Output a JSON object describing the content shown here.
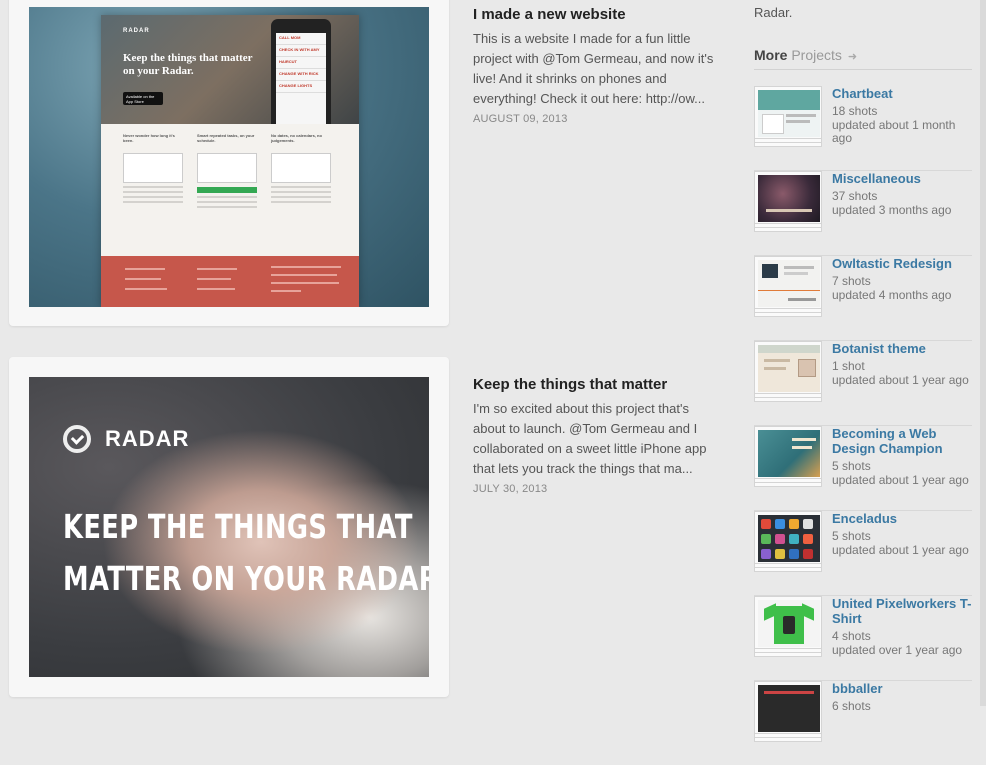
{
  "posts": [
    {
      "title": "I made a new website",
      "excerpt": "This is a website I made for a fun little project with @Tom Germeau, and now it's live! And it shrinks on phones and everything! Check it out here: http://ow...",
      "date": "AUGUST 09, 2013",
      "mock": {
        "logo": "RADAR",
        "headline": "Keep the things that matter on your Radar.",
        "app_store": "Available on the App Store",
        "phone_rows": [
          "CALL MOM",
          "CHECK IN WITH AMY",
          "HAIRCUT",
          "CHANGE WITH RICK",
          "CHANGE LIGHTS"
        ],
        "columns": [
          "Never wonder how long it's been.",
          "Smart repeated tasks, on your schedule.",
          "No dates, no calendars, no judgements."
        ]
      }
    },
    {
      "title": "Keep the things that matter",
      "excerpt": "I'm so excited about this project that's about to launch. @Tom Germeau and I collaborated on a sweet little iPhone app that lets you track the things that ma...",
      "date": "JULY 30, 2013",
      "mock": {
        "logo": "RADAR",
        "headline_line1": "KEEP THE THINGS THAT",
        "headline_line2": "MATTER ON YOUR RADAR."
      }
    }
  ],
  "sidebar": {
    "top_text": "Radar.",
    "heading_strong": "More",
    "heading_light": "Projects",
    "heading_arrow": "➜",
    "projects": [
      {
        "name": "Chartbeat",
        "shots": "18 shots",
        "updated": "updated about 1 month ago"
      },
      {
        "name": "Miscellaneous",
        "shots": "37 shots",
        "updated": "updated 3 months ago"
      },
      {
        "name": "Owltastic Redesign",
        "shots": "7 shots",
        "updated": "updated 4 months ago"
      },
      {
        "name": "Botanist theme",
        "shots": "1 shot",
        "updated": "updated about 1 year ago"
      },
      {
        "name": "Becoming a Web Design Champion",
        "shots": "5 shots",
        "updated": "updated about 1 year ago"
      },
      {
        "name": "Enceladus",
        "shots": "5 shots",
        "updated": "updated about 1 year ago"
      },
      {
        "name": "United Pixelworkers T-Shirt",
        "shots": "4 shots",
        "updated": "updated over 1 year ago"
      },
      {
        "name": "bbballer",
        "shots": "6 shots",
        "updated": ""
      }
    ]
  }
}
